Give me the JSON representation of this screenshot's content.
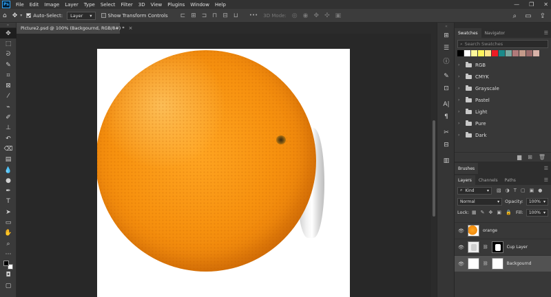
{
  "menubar": {
    "logo": "Ps",
    "items": [
      "File",
      "Edit",
      "Image",
      "Layer",
      "Type",
      "Select",
      "Filter",
      "3D",
      "View",
      "Plugins",
      "Window",
      "Help"
    ],
    "window_controls": {
      "minimize": "—",
      "restore": "❐",
      "close": "✕"
    }
  },
  "options": {
    "home_icon": "⌂",
    "move_icon": "✥",
    "auto_select_label": "Auto-Select:",
    "auto_select_checked": true,
    "target_value": "Layer",
    "transform_controls_label": "Show Transform Controls",
    "transform_controls_checked": false,
    "more_icon": "•••",
    "mode_3d": "3D Mode:",
    "right_icons": [
      "search-icon",
      "workspace-icon",
      "share-icon"
    ]
  },
  "document": {
    "tab_title": "Picture2.psd @ 100% (Backgournd, RGB/8#) *",
    "close": "×"
  },
  "colors": {
    "orange_light": "#ffaa22",
    "orange_mid": "#f78e0d",
    "orange_dark": "#d9700a",
    "canvas_white": "#ffffff",
    "app_dark": "#282828"
  },
  "swatches": {
    "tabs": [
      "Swatches",
      "Navigator"
    ],
    "search_placeholder": "Search Swatches",
    "colors": [
      "#000000",
      "#ffffff",
      "#fff79a",
      "#fff35c",
      "#ffe58a",
      "#ed1c24",
      "#1a8a8a",
      "#7aa8a0",
      "#b07a7a",
      "#c49a8a",
      "#9a6a6a",
      "#d8b2a8"
    ],
    "groups": [
      "RGB",
      "CMYK",
      "Grayscale",
      "Pastel",
      "Light",
      "Pure",
      "Dark"
    ]
  },
  "brushes": {
    "title": "Brushes"
  },
  "layers": {
    "tabs": [
      "Layers",
      "Channels",
      "Paths"
    ],
    "kind_label": "Kind",
    "blend_mode": "Normal",
    "opacity_label": "Opacity:",
    "opacity_value": "100%",
    "lock_label": "Lock:",
    "fill_label": "Fill:",
    "fill_value": "100%",
    "items": [
      {
        "name": "orange",
        "selected": false
      },
      {
        "name": "Cup Layer",
        "selected": false
      },
      {
        "name": "Backgournd",
        "selected": true
      }
    ]
  }
}
